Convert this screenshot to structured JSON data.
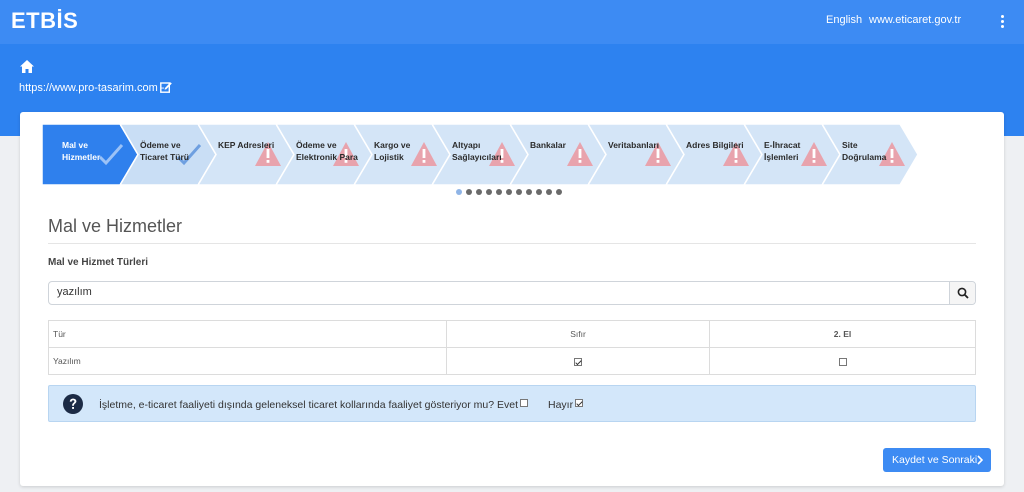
{
  "navbar": {
    "brand": "ETBİS",
    "language_link": "English",
    "site_link": "www.eticaret.gov.tr"
  },
  "header": {
    "site_url": "https://www.pro-tasarim.com -"
  },
  "steps": [
    {
      "label": "Mal ve Hizmetler",
      "status": "done",
      "active": true
    },
    {
      "label": "Ödeme ve Ticaret Türü",
      "status": "done",
      "active": false
    },
    {
      "label": "KEP Adresleri",
      "status": "warning",
      "active": false
    },
    {
      "label": "Ödeme ve Elektronik Para",
      "status": "warning",
      "active": false
    },
    {
      "label": "Kargo ve Lojistik",
      "status": "warning",
      "active": false
    },
    {
      "label": "Altyapı Sağlayıcıları",
      "status": "warning",
      "active": false
    },
    {
      "label": "Bankalar",
      "status": "warning",
      "active": false
    },
    {
      "label": "Veritabanları",
      "status": "warning",
      "active": false
    },
    {
      "label": "Adres Bilgileri",
      "status": "warning",
      "active": false
    },
    {
      "label": "E-İhracat İşlemleri",
      "status": "warning",
      "active": false
    },
    {
      "label": "Site Doğrulama",
      "status": "warning",
      "active": false
    }
  ],
  "pager": {
    "count": 11,
    "active_index": 0
  },
  "section": {
    "title": "Mal ve Hizmetler",
    "subtitle": "Mal ve Hizmet Türleri"
  },
  "search": {
    "value": "yazılım"
  },
  "table": {
    "headers": [
      "Tür",
      "Sıfır",
      "2. El"
    ],
    "rows": [
      {
        "type": "Yazılım",
        "new": true,
        "used": false
      }
    ]
  },
  "question": {
    "text": "İşletme, e-ticaret faaliyeti dışında geleneksel ticaret kollarında faaliyet gösteriyor mu?",
    "yes_label": "Evet",
    "yes_checked": false,
    "no_label": "Hayır",
    "no_checked": true
  },
  "actions": {
    "next_label": "Kaydet ve Sonraki"
  },
  "colors": {
    "primary": "#3d8bf3",
    "band": "#2d82f0",
    "step_active": "#2f80ed",
    "step_done": "#c9def5",
    "step_todo": "#d4e5f7",
    "warning": "#e8a3ad",
    "info_bg": "#d3e7fa"
  },
  "icons": {
    "home": "home-icon",
    "edit": "edit-icon",
    "check": "check-icon",
    "warning": "warning-icon",
    "search": "search-icon",
    "question": "question-circle-icon",
    "next": "chevron-right-icon",
    "menu": "kebab-menu-icon"
  }
}
